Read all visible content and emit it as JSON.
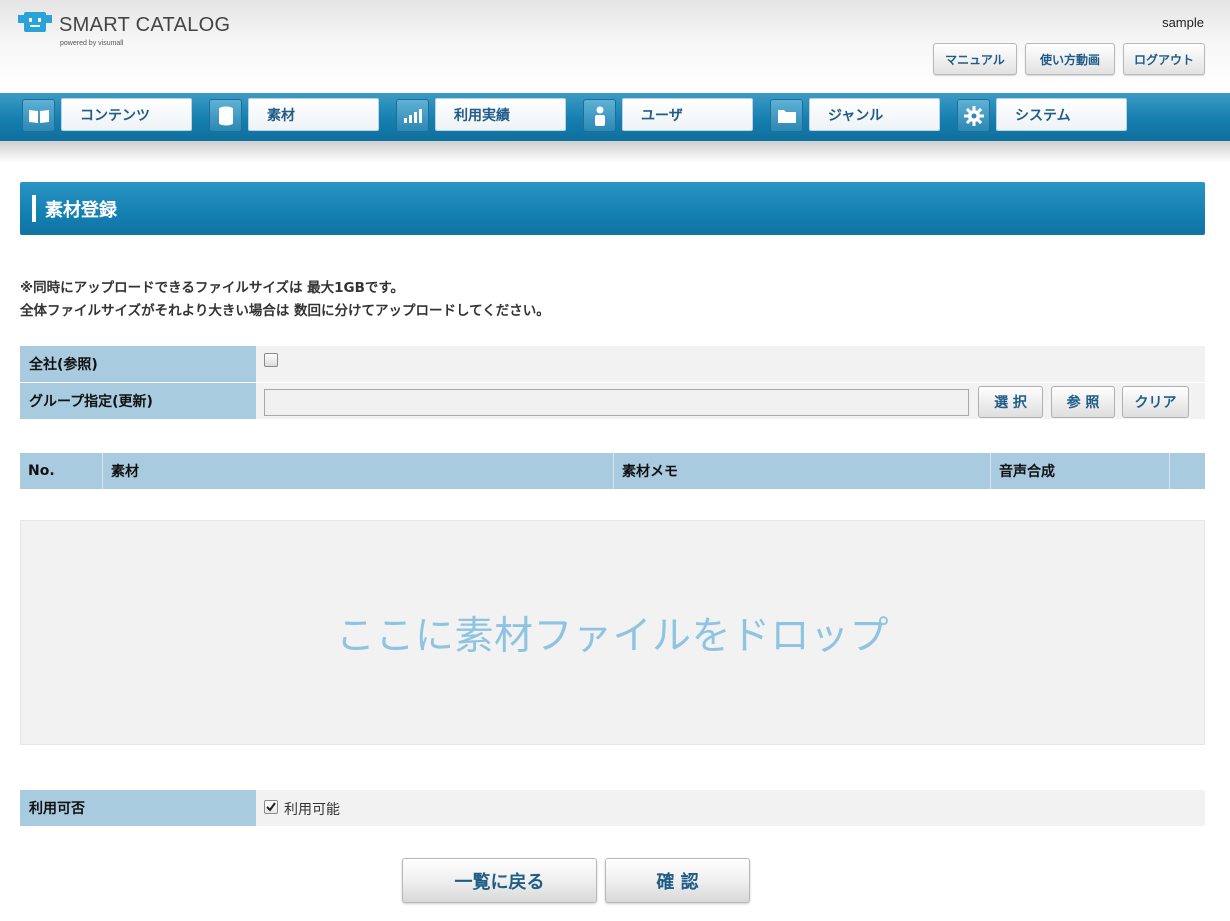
{
  "header": {
    "logo_text": "SMART CATALOG",
    "logo_sub": "powered by visumall",
    "user_name": "sample",
    "buttons": [
      {
        "label": "マニュアル"
      },
      {
        "label": "使い方動画"
      },
      {
        "label": "ログアウト"
      }
    ]
  },
  "nav": {
    "items": [
      {
        "label": "コンテンツ",
        "icon": "book-icon"
      },
      {
        "label": "素材",
        "icon": "database-icon"
      },
      {
        "label": "利用実績",
        "icon": "bar-chart-icon"
      },
      {
        "label": "ユーザ",
        "icon": "user-icon"
      },
      {
        "label": "ジャンル",
        "icon": "folder-icon"
      },
      {
        "label": "システム",
        "icon": "gear-icon"
      }
    ]
  },
  "page": {
    "title": "素材登録",
    "notice_line1": "※同時にアップロードできるファイルサイズは 最大1GBです。",
    "notice_line2": "全体ファイルサイズがそれより大きい場合は 数回に分けてアップロードしてください。"
  },
  "form": {
    "company_label": "全社(参照)",
    "company_checked": false,
    "group_label": "グループ指定(更新)",
    "group_value": "",
    "select_label": "選 択",
    "browse_label": "参 照",
    "clear_label": "クリア"
  },
  "table": {
    "headers": [
      "No.",
      "素材",
      "素材メモ",
      "音声合成"
    ]
  },
  "dropzone": {
    "text": "ここに素材ファイルをドロップ"
  },
  "availability": {
    "label": "利用可否",
    "checkbox_label": "利用可能",
    "checked": true
  },
  "actions": {
    "back_label": "一覧に戻る",
    "confirm_label": "確 認"
  },
  "colors": {
    "nav_blue": "#167fb0",
    "label_blue": "#a9cbe0",
    "button_text": "#1f5c88",
    "dropzone_text": "#8ec4e2"
  }
}
